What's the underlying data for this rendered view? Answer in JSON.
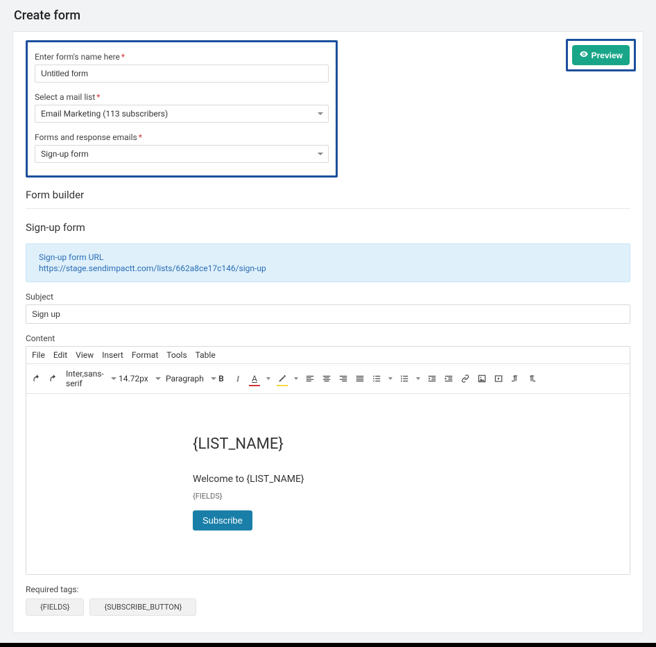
{
  "page": {
    "title": "Create form"
  },
  "preview": {
    "label": "Preview"
  },
  "config": {
    "name_label": "Enter form's name here",
    "name_value": "Untitled form",
    "maillist_label": "Select a mail list",
    "maillist_value": "Email Marketing (113 subscribers)",
    "respemail_label": "Forms and response emails",
    "respemail_value": "Sign-up form"
  },
  "builder": {
    "heading": "Form builder"
  },
  "signup": {
    "heading": "Sign-up form",
    "url_label": "Sign-up form URL",
    "url_value": "https://stage.sendimpactt.com/lists/662a8ce17c146/sign-up"
  },
  "subject": {
    "label": "Subject",
    "value": "Sign up"
  },
  "content": {
    "label": "Content"
  },
  "editor": {
    "menu": {
      "file": "File",
      "edit": "Edit",
      "view": "View",
      "insert": "Insert",
      "format": "Format",
      "tools": "Tools",
      "table": "Table"
    },
    "fontname": "Inter,sans-serif",
    "fontsize": "14.72px",
    "parstyle": "Paragraph",
    "body": {
      "h1": "{LIST_NAME}",
      "welcome": "Welcome to {LIST_NAME}",
      "fields": "{FIELDS}",
      "subscribe": "Subscribe"
    }
  },
  "required_tags": {
    "label": "Required tags:",
    "items": [
      "{FIELDS}",
      "{SUBSCRIBE_BUTTON}"
    ]
  }
}
